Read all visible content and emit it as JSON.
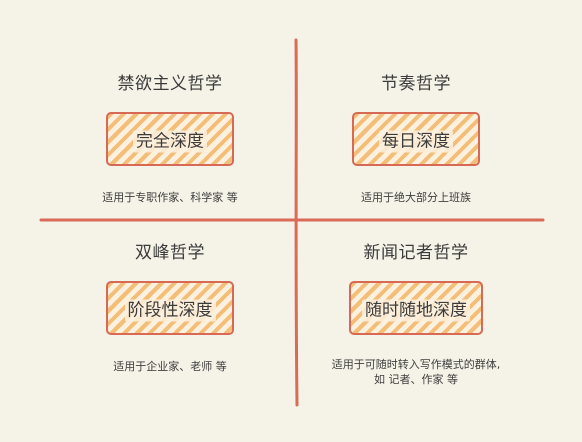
{
  "quadrants": [
    {
      "title": "禁欲主义哲学",
      "box_label": "完全深度",
      "description": "适用于专职作家、科学家 等"
    },
    {
      "title": "节奏哲学",
      "box_label": "每日深度",
      "description": "适用于绝大部分上班族"
    },
    {
      "title": "双峰哲学",
      "box_label": "阶段性深度",
      "description": "适用于企业家、老师 等"
    },
    {
      "title": "新闻记者哲学",
      "box_label": "随时随地深度",
      "description_lines": [
        "适用于可随时转入写作模式的群体,",
        "如 记者、作家 等"
      ]
    }
  ],
  "colors": {
    "background": "#f5f2e7",
    "axis": "#d96b57",
    "box_border": "#d66a55",
    "hatch": "#f4be79"
  }
}
